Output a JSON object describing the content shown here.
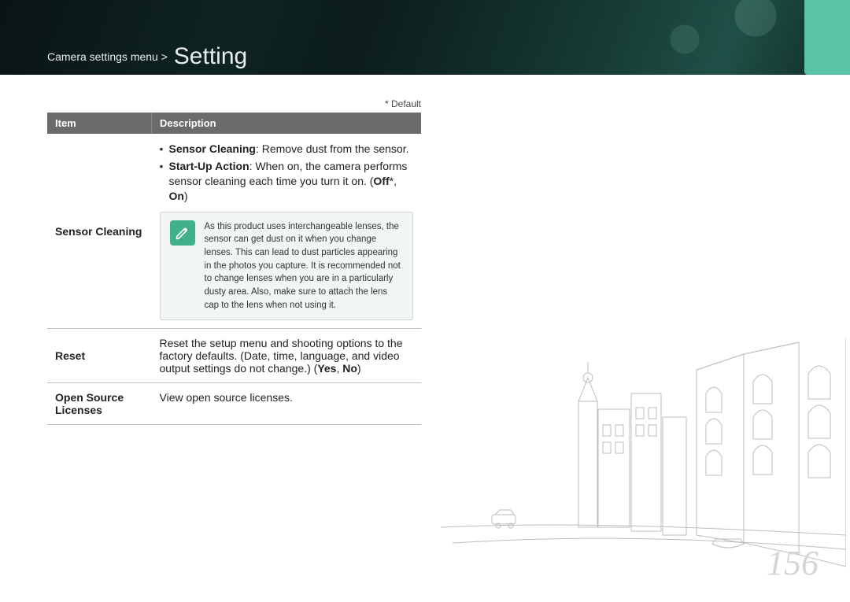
{
  "breadcrumb": {
    "parent": "Camera settings menu >",
    "current": "Setting"
  },
  "default_note": "* Default",
  "table": {
    "headers": {
      "item": "Item",
      "description": "Description"
    },
    "rows": [
      {
        "item": "Sensor Cleaning",
        "bullet1_label": "Sensor Cleaning",
        "bullet1_text": ": Remove dust from the sensor.",
        "bullet2_label": "Start-Up Action",
        "bullet2_text1": ": When on, the camera performs sensor cleaning each time you turn it on. (",
        "bullet2_opt1": "Off",
        "bullet2_star": "*, ",
        "bullet2_opt2": "On",
        "bullet2_close": ")",
        "note": "As this product uses interchangeable lenses, the sensor can get dust on it when you change lenses. This can lead to dust particles appearing in the photos you capture. It is recommended not to change lenses when you are in a particularly dusty area. Also, make sure to attach the lens cap to the lens when not using it."
      },
      {
        "item": "Reset",
        "desc_pre": "Reset the setup menu and shooting options to the factory defaults. (Date, time, language, and video output settings do not change.) (",
        "opt1": "Yes",
        "sep": ", ",
        "opt2": "No",
        "close": ")"
      },
      {
        "item": "Open Source Licenses",
        "desc": "View open source licenses."
      }
    ]
  },
  "page_number": "156"
}
